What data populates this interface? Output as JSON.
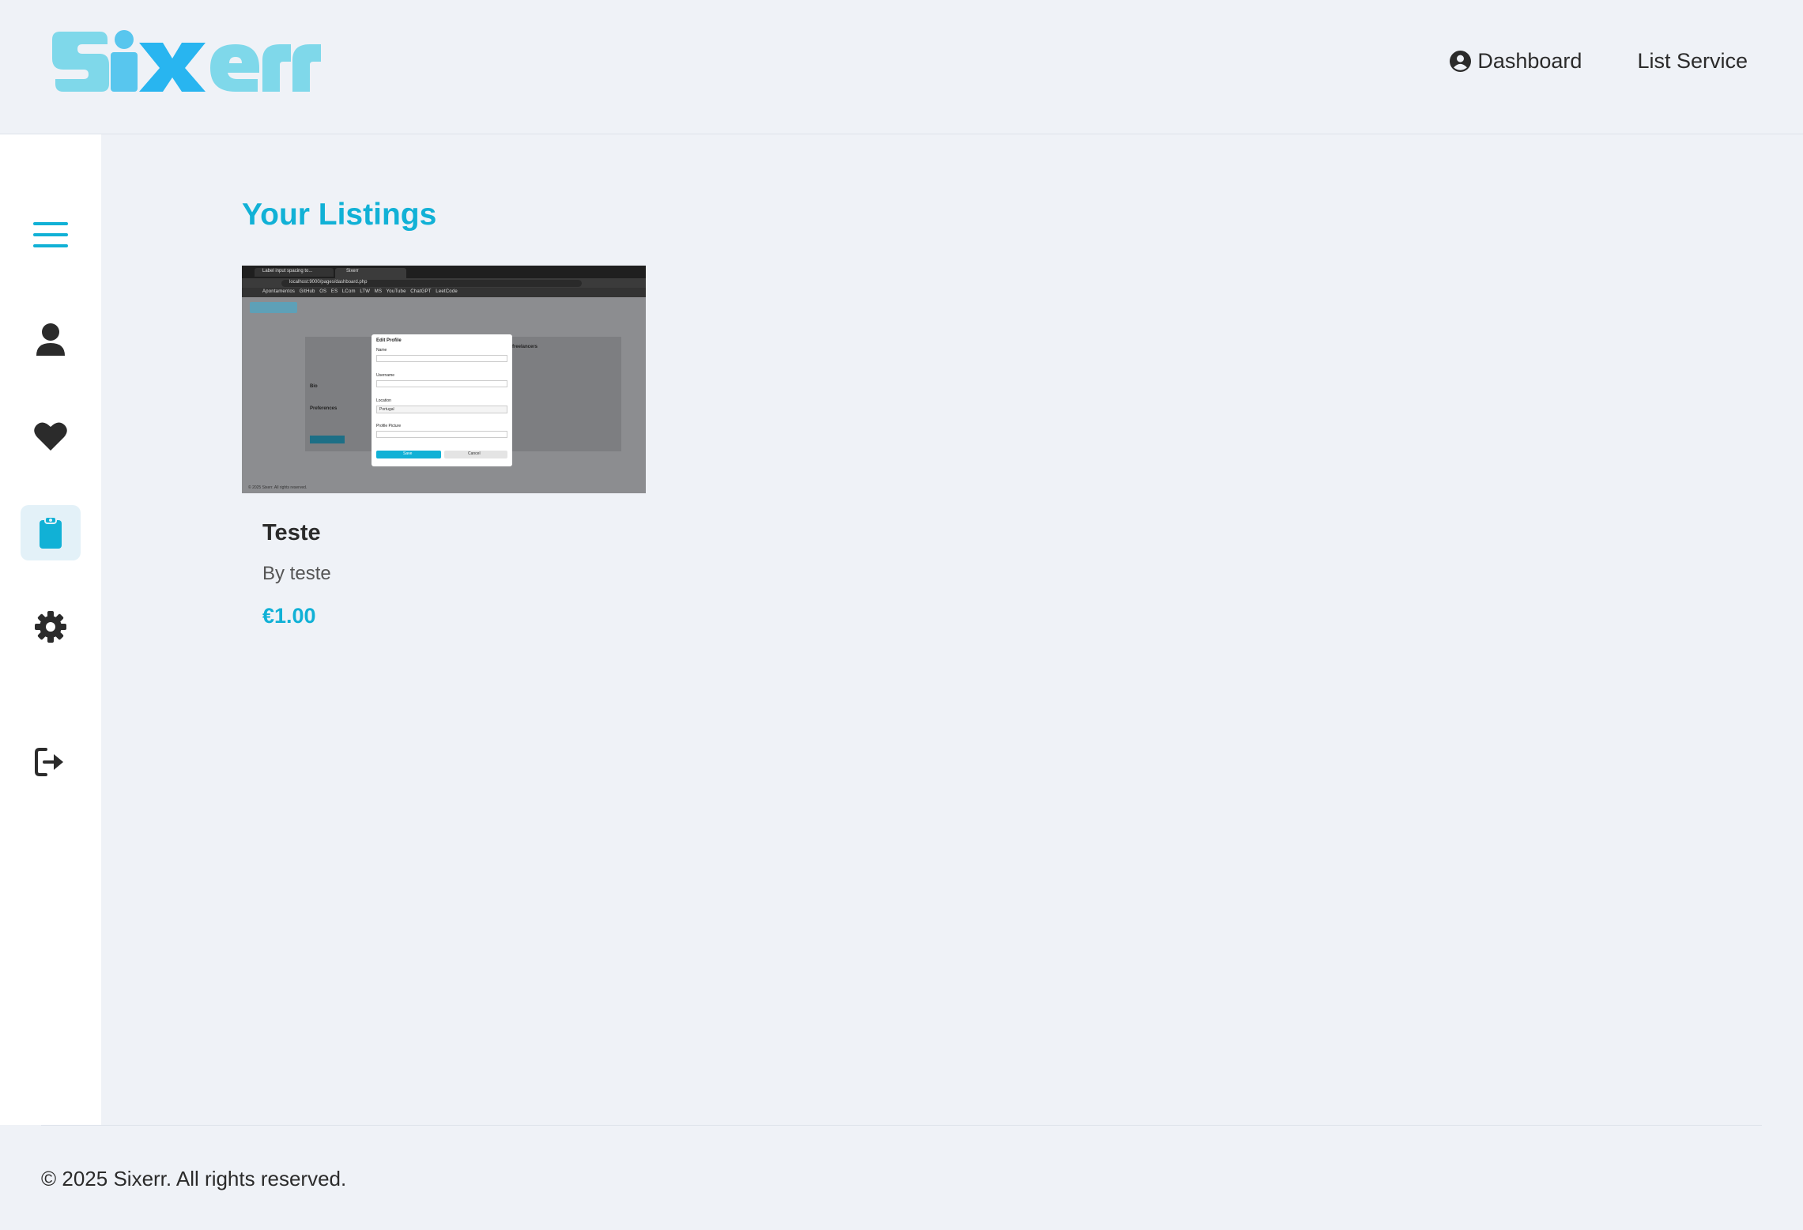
{
  "header": {
    "logo_text": "sixerr",
    "nav": {
      "dashboard": "Dashboard",
      "list_service": "List Service"
    }
  },
  "sidebar": {
    "items": [
      {
        "icon": "menu-icon"
      },
      {
        "icon": "user-icon"
      },
      {
        "icon": "heart-icon"
      },
      {
        "icon": "clipboard-icon",
        "active": true
      },
      {
        "icon": "gear-icon"
      },
      {
        "icon": "logout-icon"
      }
    ]
  },
  "main": {
    "title": "Your Listings",
    "listings": [
      {
        "title": "Teste",
        "author": "By teste",
        "price": "€1.00",
        "thumbnail": {
          "tab1": "Label input spacing to...",
          "tab2": "Sixerr",
          "url": "localhost:9000/pages/dashboard.php",
          "bookmarks": [
            "Apontamentos",
            "GitHub",
            "OS",
            "ES",
            "LCom",
            "LTW",
            "MS",
            "YouTube",
            "ChatGPT",
            "LeetCode"
          ],
          "modal_title": "Edit Profile",
          "fields": [
            "Name",
            "Username",
            "Location",
            "Profile Picture"
          ],
          "location_value": "Portugal",
          "save": "Save",
          "cancel": "Cancel",
          "bg_heading": "m from freelancers",
          "bg_bio": "Bio",
          "bg_prefs": "Preferences",
          "footer": "© 2025 Sixerr. All rights reserved."
        }
      }
    ]
  },
  "footer": {
    "copyright": "© 2025 Sixerr. All rights reserved."
  },
  "colors": {
    "accent": "#11b1d6",
    "logo_light": "#7fd8ea",
    "logo_dark": "#28b5f0",
    "background": "#eff2f7"
  }
}
